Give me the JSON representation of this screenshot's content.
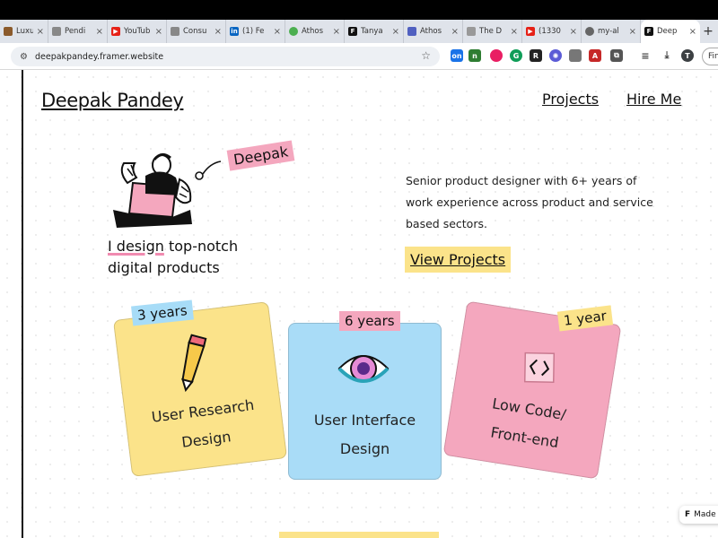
{
  "browser": {
    "tabs": [
      {
        "label": "Luxury",
        "color": "#8b5a2b"
      },
      {
        "label": "Pendi",
        "color": "#888888"
      },
      {
        "label": "YouTub",
        "color": "#e62117"
      },
      {
        "label": "Consu",
        "color": "#888888"
      },
      {
        "label": "(1) Fe",
        "color": "#0a66c2"
      },
      {
        "label": "Athos",
        "color": "#4caf50"
      },
      {
        "label": "Tanya",
        "color": "#111111"
      },
      {
        "label": "Athos",
        "color": "#5060c0"
      },
      {
        "label": "The D",
        "color": "#999999"
      },
      {
        "label": "(1330",
        "color": "#e62117"
      },
      {
        "label": "my-al",
        "color": "#666666"
      },
      {
        "label": "Deep",
        "color": "#111111"
      }
    ],
    "url": "deepakpandey.framer.website",
    "find_label": "Fin"
  },
  "page": {
    "logo": "Deepak Pandey",
    "nav": {
      "projects": "Projects",
      "hire": "Hire Me"
    },
    "name_tag": "Deepak",
    "tagline": {
      "highlight": "I design",
      "rest": " top-notch",
      "line2": "digital products"
    },
    "description": "Senior product designer with 6+ years of work experience across product and service based sectors.",
    "cta": "View Projects",
    "cards": [
      {
        "badge": "3 years",
        "line1": "User Research",
        "line2": "Design",
        "color": "#fbe38a",
        "badge_color": "#a7dcf7"
      },
      {
        "badge": "6 years",
        "line1": "User Interface",
        "line2": "Design",
        "color": "#a9dcf7",
        "badge_color": "#f4a7be"
      },
      {
        "badge": "1 year",
        "line1": "Low Code/",
        "line2": "Front-end",
        "color": "#f4a7be",
        "badge_color": "#fbe38a"
      }
    ],
    "made_in": "Made"
  }
}
